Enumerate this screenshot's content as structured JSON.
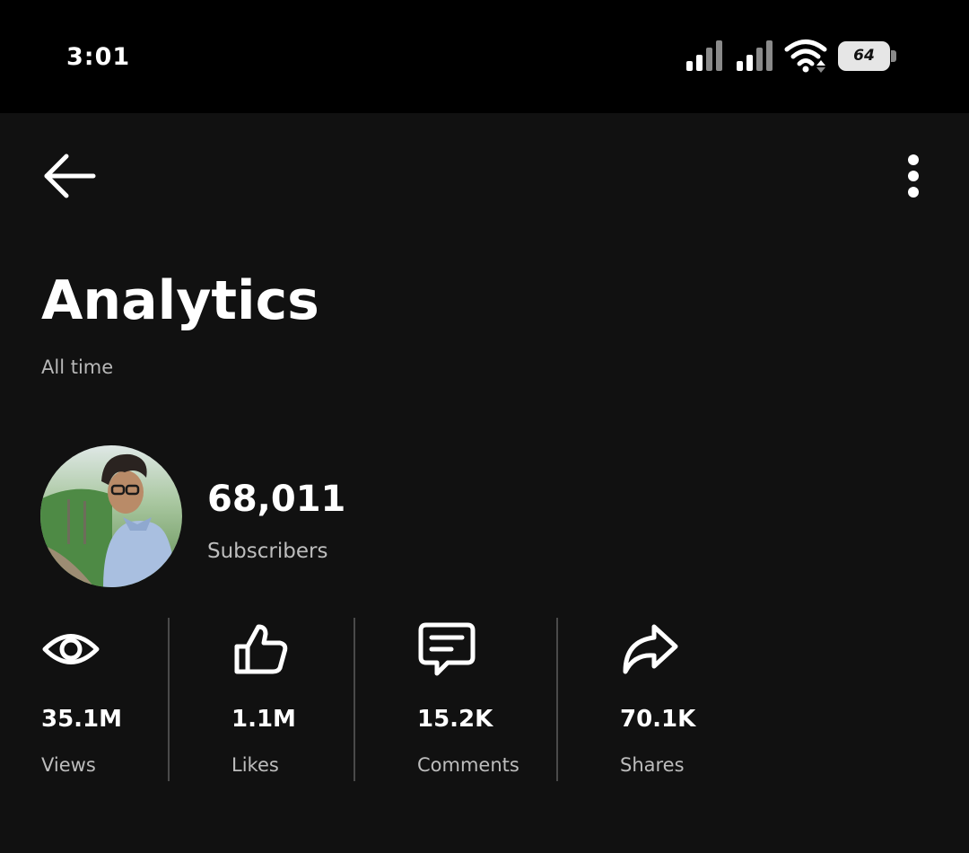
{
  "status_bar": {
    "time": "3:01",
    "battery_level": "64",
    "icons": [
      "signal-icon",
      "signal-icon",
      "wifi-icon",
      "battery-icon"
    ]
  },
  "header": {
    "back_icon": "back-arrow-icon",
    "menu_icon": "more-vertical-icon"
  },
  "page": {
    "title": "Analytics",
    "period": "All time"
  },
  "channel": {
    "subscriber_count": "68,011",
    "subscriber_label": "Subscribers"
  },
  "stats": [
    {
      "icon": "eye-icon",
      "value": "35.1M",
      "label": "Views"
    },
    {
      "icon": "thumbs-up-icon",
      "value": "1.1M",
      "label": "Likes"
    },
    {
      "icon": "comment-icon",
      "value": "15.2K",
      "label": "Comments"
    },
    {
      "icon": "share-icon",
      "value": "70.1K",
      "label": "Shares"
    }
  ],
  "colors": {
    "background": "#111111",
    "status_bar": "#000000",
    "text_primary": "#ffffff",
    "text_secondary": "#bdbdbd",
    "divider": "#4a4a4a"
  }
}
